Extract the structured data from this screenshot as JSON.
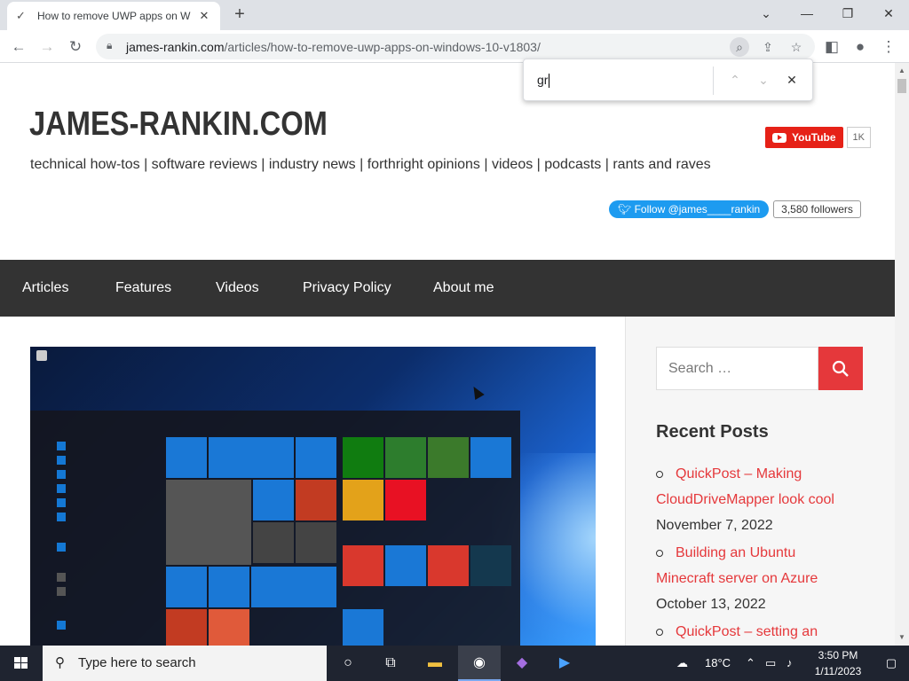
{
  "browser": {
    "tab_title": "How to remove UWP apps on W",
    "new_tab_label": "+",
    "url_domain": "james-rankin.com",
    "url_path": "/articles/how-to-remove-uwp-apps-on-windows-10-v1803/"
  },
  "find_bar": {
    "value": "gr"
  },
  "site": {
    "title": "JAMES-RANKIN.COM",
    "tagline": "technical how-tos | software reviews | industry news | forthright opinions | videos | podcasts | rants and raves",
    "youtube_label": "YouTube",
    "youtube_count": "1K",
    "twitter_label": "Follow @james____rankin",
    "twitter_count": "3,580 followers"
  },
  "nav": [
    "Articles",
    "Features",
    "Videos",
    "Privacy Policy",
    "About me"
  ],
  "sidebar": {
    "search_placeholder": "Search …",
    "recent_posts_title": "Recent Posts",
    "posts": [
      {
        "link_a": "QuickPost – Making",
        "link_b": "CloudDriveMapper look cool",
        "date": "November 7, 2022"
      },
      {
        "link_a": "Building an Ubuntu",
        "link_b": "Minecraft server on Azure",
        "date": "October 13, 2022"
      },
      {
        "link_a": "QuickPost – setting an"
      }
    ]
  },
  "taskbar": {
    "search_placeholder": "Type here to search",
    "weather": "18°C",
    "time": "3:50 PM",
    "date": "1/11/2023"
  },
  "colors": {
    "accent": "#e5383b",
    "nav_bg": "#333333",
    "youtube": "#e62117",
    "twitter": "#1d9bf0"
  }
}
